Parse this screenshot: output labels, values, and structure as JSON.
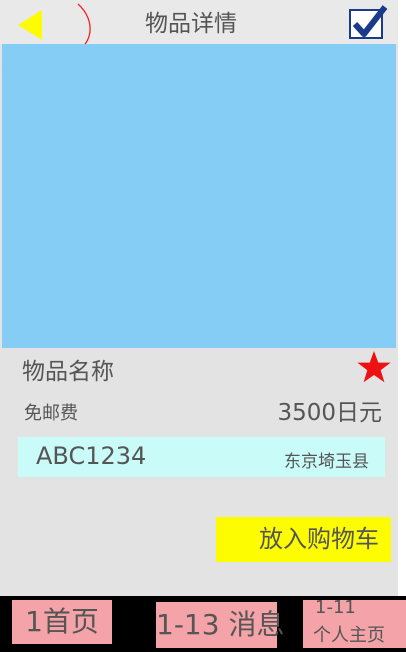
{
  "header": {
    "title": "物品详情",
    "back_icon": "triangle-left-icon",
    "confirm_icon": "checkbox-checked-icon"
  },
  "colors": {
    "background": "#e3e3e3",
    "image_placeholder": "#86cdf5",
    "code_box": "#c9fbf8",
    "cart_button": "#fdfc00",
    "tab": "#f4a3a8",
    "tabbar": "#000000",
    "star": "#ee1111",
    "back_arrow": "#fdfc00",
    "check": "#1a3a8a"
  },
  "item": {
    "name": "物品名称",
    "shipping": "免邮费",
    "price": "3500日元",
    "code": "ABC1234",
    "location": "东京埼玉县",
    "favorite_icon": "star-icon"
  },
  "actions": {
    "add_to_cart": "放入购物车"
  },
  "tabbar": {
    "home": "1首页",
    "messages": "1-13 消息",
    "profile_code": "1-11",
    "profile_label": "个人主页"
  }
}
